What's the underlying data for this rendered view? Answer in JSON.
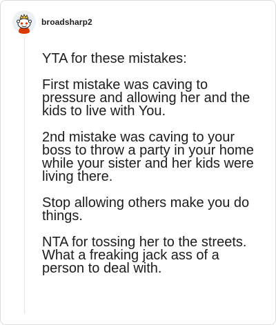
{
  "comment": {
    "username": "broadsharp2",
    "avatar_icon": "snoo-avatar-icon",
    "paragraphs": [
      "YTA for these mistakes:",
      "First mistake was caving to pressure and allowing her and the kids to live with You.",
      "2nd mistake was caving to your boss to throw a party in your home while your sister and her kids were living there.",
      "Stop allowing others make you do things.",
      "NTA for tossing her to the streets. What a freaking jack ass of a person to deal with."
    ]
  },
  "colors": {
    "text": "#1c1c1c",
    "border": "#dcdcdc",
    "thread_line": "#e4e4e4"
  }
}
